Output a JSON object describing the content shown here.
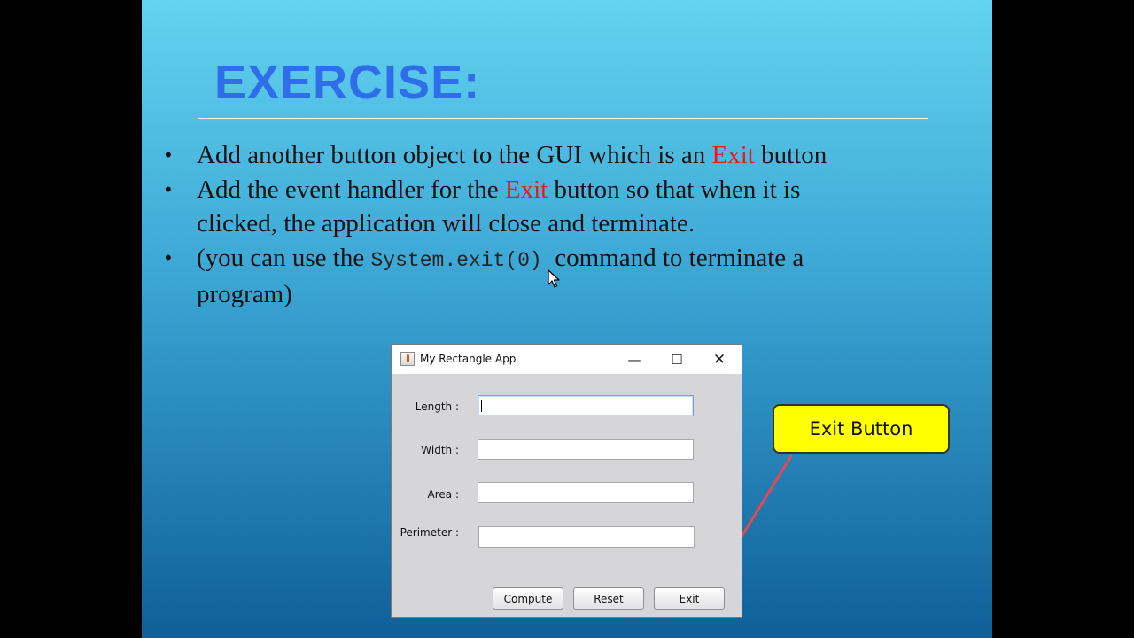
{
  "slide": {
    "title": "EXERCISE:",
    "bullets": [
      {
        "before": "Add another button object to the GUI which is an ",
        "highlight": "Exit",
        "after": " button"
      },
      {
        "before": "Add the event handler for the ",
        "highlight": "Exit",
        "after": " button so that when it is",
        "line2": "clicked, the application will close and terminate."
      },
      {
        "before": "(you can use the ",
        "code": "System.exit(0)",
        "after": "  command to terminate a",
        "line2": "program)"
      }
    ],
    "bullet_glyph": "•"
  },
  "window": {
    "title": "My Rectangle App",
    "controls": {
      "minimize": "—",
      "maximize": "☐",
      "close": "✕"
    },
    "fields": [
      {
        "label": "Length :",
        "value": ""
      },
      {
        "label": "Width :",
        "value": ""
      },
      {
        "label": "Area :",
        "value": ""
      },
      {
        "label": "Perimeter :",
        "value": ""
      }
    ],
    "buttons": {
      "compute": "Compute",
      "reset": "Reset",
      "exit": "Exit"
    }
  },
  "callout": {
    "text": "Exit Button",
    "fill": "#ffff00"
  },
  "colors": {
    "accent_title": "#2f6ee8",
    "highlight_red": "#e8191c",
    "arrow": "#e8474f"
  },
  "icons": {
    "app": "java-cup-icon",
    "cursor": "mouse-pointer-icon"
  }
}
